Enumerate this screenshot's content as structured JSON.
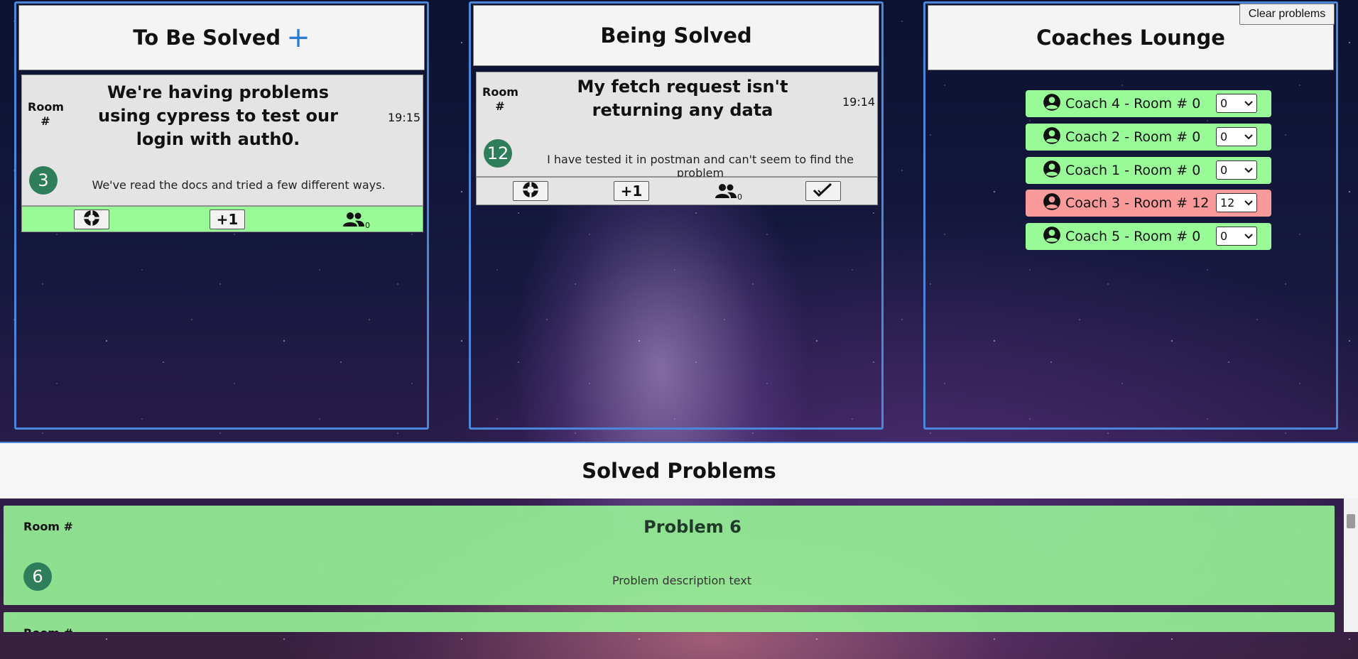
{
  "columns": {
    "to_be_solved": {
      "title": "To Be Solved",
      "add_symbol": "+"
    },
    "being_solved": {
      "title": "Being Solved"
    },
    "coaches_lounge": {
      "title": "Coaches Lounge"
    }
  },
  "clear_button": "Clear problems",
  "to_be_solved_card": {
    "room_label": "Room #",
    "title": "We're having problems using cypress to test our login with auth0.",
    "time": "19:15",
    "room_number": "3",
    "description": "We've read the docs and tried a few different ways.",
    "plus_one": "+1",
    "helpers_count": "0",
    "action_bar_color": "#98fb98"
  },
  "being_solved_card": {
    "room_label": "Room #",
    "title": "My fetch request isn't returning any data",
    "time": "19:14",
    "room_number": "12",
    "description": "I have tested it in postman and can't seem to find the problem",
    "plus_one": "+1",
    "helpers_count": "0"
  },
  "coaches": [
    {
      "name": "Coach 4 - Room # 0",
      "room": "0",
      "status_color": "#98fb98"
    },
    {
      "name": "Coach 2 - Room # 0",
      "room": "0",
      "status_color": "#98fb98"
    },
    {
      "name": "Coach 1 - Room # 0",
      "room": "0",
      "status_color": "#98fb98"
    },
    {
      "name": "Coach 3 - Room # 12",
      "room": "12",
      "status_color": "#fa9a9a"
    },
    {
      "name": "Coach 5 - Room # 0",
      "room": "0",
      "status_color": "#98fb98"
    }
  ],
  "solved": {
    "title": "Solved Problems",
    "items": [
      {
        "room_label": "Room #",
        "title": "Problem 6",
        "room_number": "6",
        "description": "Problem description text"
      },
      {
        "room_label": "Room #"
      }
    ]
  },
  "colors": {
    "accent_border": "#4a86d9",
    "badge": "#2e7d5b",
    "plus": "#2b7bd4"
  }
}
